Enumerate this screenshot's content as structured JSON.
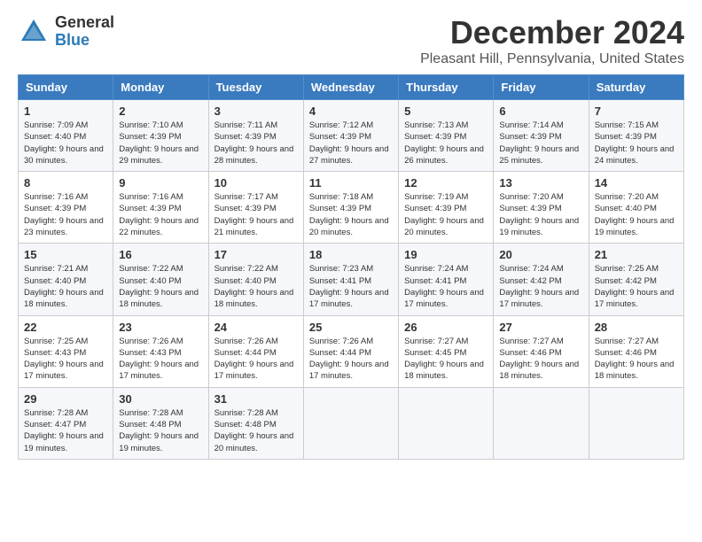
{
  "logo": {
    "general": "General",
    "blue": "Blue"
  },
  "title": "December 2024",
  "subtitle": "Pleasant Hill, Pennsylvania, United States",
  "days_of_week": [
    "Sunday",
    "Monday",
    "Tuesday",
    "Wednesday",
    "Thursday",
    "Friday",
    "Saturday"
  ],
  "weeks": [
    [
      {
        "day": "1",
        "sunrise": "Sunrise: 7:09 AM",
        "sunset": "Sunset: 4:40 PM",
        "daylight": "Daylight: 9 hours and 30 minutes."
      },
      {
        "day": "2",
        "sunrise": "Sunrise: 7:10 AM",
        "sunset": "Sunset: 4:39 PM",
        "daylight": "Daylight: 9 hours and 29 minutes."
      },
      {
        "day": "3",
        "sunrise": "Sunrise: 7:11 AM",
        "sunset": "Sunset: 4:39 PM",
        "daylight": "Daylight: 9 hours and 28 minutes."
      },
      {
        "day": "4",
        "sunrise": "Sunrise: 7:12 AM",
        "sunset": "Sunset: 4:39 PM",
        "daylight": "Daylight: 9 hours and 27 minutes."
      },
      {
        "day": "5",
        "sunrise": "Sunrise: 7:13 AM",
        "sunset": "Sunset: 4:39 PM",
        "daylight": "Daylight: 9 hours and 26 minutes."
      },
      {
        "day": "6",
        "sunrise": "Sunrise: 7:14 AM",
        "sunset": "Sunset: 4:39 PM",
        "daylight": "Daylight: 9 hours and 25 minutes."
      },
      {
        "day": "7",
        "sunrise": "Sunrise: 7:15 AM",
        "sunset": "Sunset: 4:39 PM",
        "daylight": "Daylight: 9 hours and 24 minutes."
      }
    ],
    [
      {
        "day": "8",
        "sunrise": "Sunrise: 7:16 AM",
        "sunset": "Sunset: 4:39 PM",
        "daylight": "Daylight: 9 hours and 23 minutes."
      },
      {
        "day": "9",
        "sunrise": "Sunrise: 7:16 AM",
        "sunset": "Sunset: 4:39 PM",
        "daylight": "Daylight: 9 hours and 22 minutes."
      },
      {
        "day": "10",
        "sunrise": "Sunrise: 7:17 AM",
        "sunset": "Sunset: 4:39 PM",
        "daylight": "Daylight: 9 hours and 21 minutes."
      },
      {
        "day": "11",
        "sunrise": "Sunrise: 7:18 AM",
        "sunset": "Sunset: 4:39 PM",
        "daylight": "Daylight: 9 hours and 20 minutes."
      },
      {
        "day": "12",
        "sunrise": "Sunrise: 7:19 AM",
        "sunset": "Sunset: 4:39 PM",
        "daylight": "Daylight: 9 hours and 20 minutes."
      },
      {
        "day": "13",
        "sunrise": "Sunrise: 7:20 AM",
        "sunset": "Sunset: 4:39 PM",
        "daylight": "Daylight: 9 hours and 19 minutes."
      },
      {
        "day": "14",
        "sunrise": "Sunrise: 7:20 AM",
        "sunset": "Sunset: 4:40 PM",
        "daylight": "Daylight: 9 hours and 19 minutes."
      }
    ],
    [
      {
        "day": "15",
        "sunrise": "Sunrise: 7:21 AM",
        "sunset": "Sunset: 4:40 PM",
        "daylight": "Daylight: 9 hours and 18 minutes."
      },
      {
        "day": "16",
        "sunrise": "Sunrise: 7:22 AM",
        "sunset": "Sunset: 4:40 PM",
        "daylight": "Daylight: 9 hours and 18 minutes."
      },
      {
        "day": "17",
        "sunrise": "Sunrise: 7:22 AM",
        "sunset": "Sunset: 4:40 PM",
        "daylight": "Daylight: 9 hours and 18 minutes."
      },
      {
        "day": "18",
        "sunrise": "Sunrise: 7:23 AM",
        "sunset": "Sunset: 4:41 PM",
        "daylight": "Daylight: 9 hours and 17 minutes."
      },
      {
        "day": "19",
        "sunrise": "Sunrise: 7:24 AM",
        "sunset": "Sunset: 4:41 PM",
        "daylight": "Daylight: 9 hours and 17 minutes."
      },
      {
        "day": "20",
        "sunrise": "Sunrise: 7:24 AM",
        "sunset": "Sunset: 4:42 PM",
        "daylight": "Daylight: 9 hours and 17 minutes."
      },
      {
        "day": "21",
        "sunrise": "Sunrise: 7:25 AM",
        "sunset": "Sunset: 4:42 PM",
        "daylight": "Daylight: 9 hours and 17 minutes."
      }
    ],
    [
      {
        "day": "22",
        "sunrise": "Sunrise: 7:25 AM",
        "sunset": "Sunset: 4:43 PM",
        "daylight": "Daylight: 9 hours and 17 minutes."
      },
      {
        "day": "23",
        "sunrise": "Sunrise: 7:26 AM",
        "sunset": "Sunset: 4:43 PM",
        "daylight": "Daylight: 9 hours and 17 minutes."
      },
      {
        "day": "24",
        "sunrise": "Sunrise: 7:26 AM",
        "sunset": "Sunset: 4:44 PM",
        "daylight": "Daylight: 9 hours and 17 minutes."
      },
      {
        "day": "25",
        "sunrise": "Sunrise: 7:26 AM",
        "sunset": "Sunset: 4:44 PM",
        "daylight": "Daylight: 9 hours and 17 minutes."
      },
      {
        "day": "26",
        "sunrise": "Sunrise: 7:27 AM",
        "sunset": "Sunset: 4:45 PM",
        "daylight": "Daylight: 9 hours and 18 minutes."
      },
      {
        "day": "27",
        "sunrise": "Sunrise: 7:27 AM",
        "sunset": "Sunset: 4:46 PM",
        "daylight": "Daylight: 9 hours and 18 minutes."
      },
      {
        "day": "28",
        "sunrise": "Sunrise: 7:27 AM",
        "sunset": "Sunset: 4:46 PM",
        "daylight": "Daylight: 9 hours and 18 minutes."
      }
    ],
    [
      {
        "day": "29",
        "sunrise": "Sunrise: 7:28 AM",
        "sunset": "Sunset: 4:47 PM",
        "daylight": "Daylight: 9 hours and 19 minutes."
      },
      {
        "day": "30",
        "sunrise": "Sunrise: 7:28 AM",
        "sunset": "Sunset: 4:48 PM",
        "daylight": "Daylight: 9 hours and 19 minutes."
      },
      {
        "day": "31",
        "sunrise": "Sunrise: 7:28 AM",
        "sunset": "Sunset: 4:48 PM",
        "daylight": "Daylight: 9 hours and 20 minutes."
      },
      null,
      null,
      null,
      null
    ]
  ]
}
